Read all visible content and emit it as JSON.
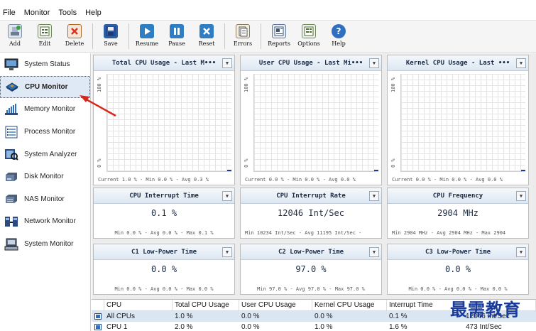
{
  "menu": [
    "File",
    "Monitor",
    "Tools",
    "Help"
  ],
  "toolbar": [
    {
      "label": "Add",
      "icon": "add-icon"
    },
    {
      "label": "Edit",
      "icon": "edit-icon"
    },
    {
      "label": "Delete",
      "icon": "delete-icon"
    },
    {
      "label": "Save",
      "icon": "save-icon"
    },
    {
      "label": "Resume",
      "icon": "play-icon"
    },
    {
      "label": "Pause",
      "icon": "pause-icon"
    },
    {
      "label": "Reset",
      "icon": "reset-icon"
    },
    {
      "label": "Errors",
      "icon": "errors-icon"
    },
    {
      "label": "Reports",
      "icon": "reports-icon"
    },
    {
      "label": "Options",
      "icon": "options-icon"
    },
    {
      "label": "Help",
      "icon": "help-icon"
    }
  ],
  "sidebar": [
    {
      "label": "System Status",
      "icon": "system-status-icon"
    },
    {
      "label": "CPU Monitor",
      "icon": "cpu-icon",
      "active": true
    },
    {
      "label": "Memory Monitor",
      "icon": "memory-icon"
    },
    {
      "label": "Process Monitor",
      "icon": "process-icon"
    },
    {
      "label": "System Analyzer",
      "icon": "analyzer-icon"
    },
    {
      "label": "Disk Monitor",
      "icon": "disk-icon"
    },
    {
      "label": "NAS Monitor",
      "icon": "nas-icon"
    },
    {
      "label": "Network Monitor",
      "icon": "network-icon"
    },
    {
      "label": "System Monitor",
      "icon": "system-monitor-icon"
    }
  ],
  "graphs": [
    {
      "title": "Total CPU Usage - Last M•••",
      "y_top": "100 %",
      "y_bottom": "0 %",
      "footer": "Current 1.0 % - Min 0.0 % - Avg 0.3 %"
    },
    {
      "title": "User CPU Usage - Last Mi•••",
      "y_top": "100 %",
      "y_bottom": "0 %",
      "footer": "Current 0.0 % - Min 0.0 % - Avg 0.0 %"
    },
    {
      "title": "Kernel CPU Usage - Last •••",
      "y_top": "100 %",
      "y_bottom": "0 %",
      "footer": "Current 0.0 % - Min 0.0 % - Avg 0.0 %"
    }
  ],
  "stats": [
    {
      "title": "CPU Interrupt Time",
      "value": "0.1 %",
      "footer": "Min 0.0 % - Avg 0.0 % - Max 0.1 %"
    },
    {
      "title": "CPU Interrupt Rate",
      "value": "12046 Int/Sec",
      "footer": "Min 10234 Int/Sec - Avg 11195 Int/Sec -"
    },
    {
      "title": "CPU Frequency",
      "value": "2904 MHz",
      "footer": "Min 2904 MHz - Avg 2904 MHz - Max 2904"
    },
    {
      "title": "C1 Low-Power Time",
      "value": "0.0 %",
      "footer": "Min 0.0 % - Avg 0.0 % - Max 0.0 %"
    },
    {
      "title": "C2 Low-Power Time",
      "value": "97.0 %",
      "footer": "Min 97.0 % - Avg 97.0 % - Max 97.0 %"
    },
    {
      "title": "C3 Low-Power Time",
      "value": "0.0 %",
      "footer": "Min 0.0 % - Avg 0.0 % - Max 0.0 %"
    }
  ],
  "table": {
    "columns": [
      "CPU",
      "Total CPU Usage",
      "User CPU Usage",
      "Kernel CPU Usage",
      "Interrupt Time",
      ""
    ],
    "rows": [
      [
        "All CPUs",
        "1.0 %",
        "0.0 %",
        "0.0 %",
        "0.1 %",
        "12046 Int/Sec"
      ],
      [
        "CPU 1",
        "2.0 %",
        "0.0 %",
        "1.0 %",
        "1.6 %",
        "473 Int/Sec"
      ]
    ]
  },
  "watermark": "最需教育",
  "colors": {
    "accent": "#1e3c8c",
    "arrow": "#d9261c",
    "watermark": "#1a3b9c"
  }
}
